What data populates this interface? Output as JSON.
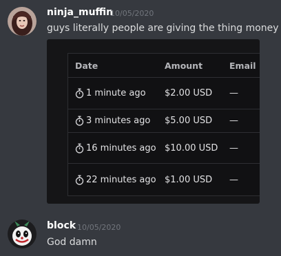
{
  "messages": [
    {
      "username": "ninja_muffin",
      "timestamp": "10/05/2020",
      "text": "guys literally people are giving the thing money",
      "avatar_icon": "user-avatar-photo"
    },
    {
      "username": "block",
      "timestamp": "10/05/2020",
      "text": "God damn",
      "avatar_icon": "clown-avatar-icon"
    }
  ],
  "embed": {
    "table": {
      "headers": [
        "Date",
        "Amount",
        "Email"
      ],
      "rows": [
        {
          "date": "1 minute ago",
          "amount": "$2.00 USD",
          "email": "—"
        },
        {
          "date": "3 minutes ago",
          "amount": "$5.00 USD",
          "email": "—"
        },
        {
          "date": "16 minutes ago",
          "amount": "$10.00 USD",
          "email": "—"
        },
        {
          "date": "22 minutes ago",
          "amount": "$1.00 USD",
          "email": "—"
        }
      ],
      "row_icon": "stopwatch-icon"
    }
  },
  "colors": {
    "background": "#36393f",
    "username": "#ffffff",
    "timestamp": "#72767d",
    "embed_background": "#151517"
  }
}
